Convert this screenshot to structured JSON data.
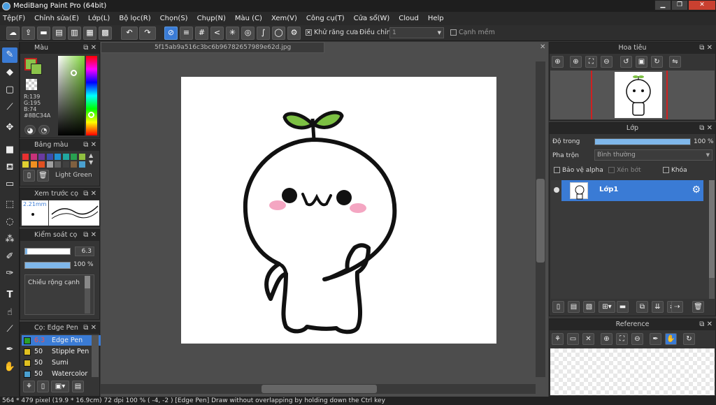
{
  "window": {
    "title": "MediBang Paint Pro (64bit)",
    "min": "▁",
    "restore": "❐",
    "close": "✕"
  },
  "menu": [
    "Tệp(F)",
    "Chỉnh sửa(E)",
    "Lớp(L)",
    "Bộ lọc(R)",
    "Chọn(S)",
    "Chụp(N)",
    "Màu (C)",
    "Xem(V)",
    "Công cụ(T)",
    "Cửa sổ(W)",
    "Cloud",
    "Help"
  ],
  "toolbar": {
    "antialias_label": "Khử răng cưa",
    "adjust_label": "Điều chỉnh",
    "adjust_value": "1",
    "smooth_label": "Cạnh mềm"
  },
  "color_panel": {
    "title": "Màu",
    "r": "R:139",
    "g": "G:195",
    "b": "B:74",
    "hex": "#8BC34A",
    "accent": "#8BC34A"
  },
  "palette_panel": {
    "title": "Bảng màu",
    "name": "Light Green",
    "colors": [
      "#e83030",
      "#c8327a",
      "#6a3aa0",
      "#3a50b0",
      "#2090d0",
      "#20a8a0",
      "#28a050",
      "#90c040",
      "#e0d030",
      "#f09020",
      "#e05020",
      "#a0a0a0",
      "#606060",
      "#404040",
      "#806040",
      "#4aa0d0"
    ]
  },
  "preview_panel": {
    "title": "Xem trước cọ",
    "size": "2.21mm"
  },
  "brush_ctrl": {
    "title": "Kiểm soát cọ",
    "size_value": "6.3",
    "opacity_value": "100 %",
    "size_fraction": 0.04,
    "opacity_fraction": 1.0,
    "option_label": "Chiều rộng cạnh"
  },
  "brush_list": {
    "title": "Cọ: Edge Pen",
    "items": [
      {
        "size": "6.3",
        "name": "Edge Pen",
        "color": "#2ca02c",
        "selected": true
      },
      {
        "size": "50",
        "name": "Stipple Pen",
        "color": "#e0c020",
        "selected": false
      },
      {
        "size": "50",
        "name": "Sumi",
        "color": "#e0c020",
        "selected": false
      },
      {
        "size": "50",
        "name": "Watercolor",
        "color": "#4aa0d0",
        "selected": false
      }
    ]
  },
  "document": {
    "tab": "5f15ab9a516c3bc6b96782657989e62d.jpg",
    "close": "✕"
  },
  "navigator": {
    "title": "Hoa tiêu"
  },
  "layer_panel": {
    "title": "Lớp",
    "opacity_label": "Độ trong",
    "opacity_value": "100 %",
    "opacity_fraction": 1.0,
    "blend_label": "Pha trộn",
    "blend_value": "Bình thường",
    "protect_alpha": "Bảo vệ alpha",
    "clipping": "Xén bớt",
    "lock": "Khóa",
    "layer_name": "Lớp1"
  },
  "reference_panel": {
    "title": "Reference"
  },
  "status": {
    "text": "564 * 479 pixel  (19.9 * 16.9cm)  72 dpi  100 %  ( -4, -2 )  [Edge Pen] Draw without overlapping by holding down the Ctrl key"
  }
}
